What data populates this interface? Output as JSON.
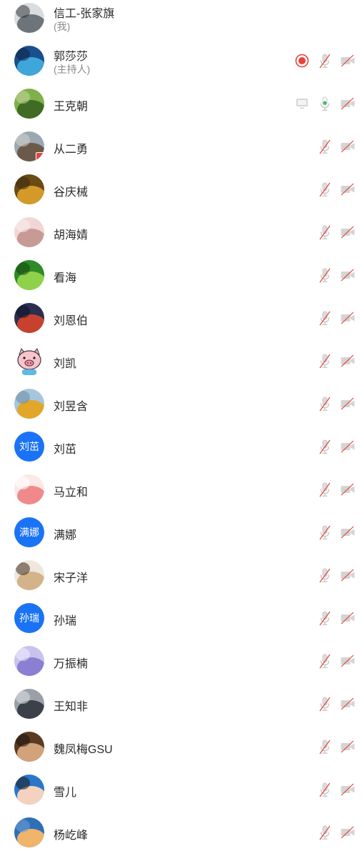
{
  "participants": [
    {
      "name": "信工-张家旗",
      "role": "(我)",
      "avatar": {
        "type": "photo",
        "colors": [
          "#d9dde0",
          "#6d747a",
          "#2e3439"
        ]
      },
      "icons": []
    },
    {
      "name": "郭莎莎",
      "role": "(主持人)",
      "avatar": {
        "type": "photo",
        "colors": [
          "#1a4f8f",
          "#3ea6d8",
          "#0c2346"
        ]
      },
      "icons": [
        "record-icon",
        "mic-muted-icon",
        "camera-off-icon"
      ]
    },
    {
      "name": "王克朝",
      "avatar": {
        "type": "photo",
        "colors": [
          "#7fb04a",
          "#3f6b22",
          "#c9d9a0"
        ]
      },
      "icons": [
        "screen-share-icon",
        "mic-active-icon",
        "camera-off-icon"
      ]
    },
    {
      "name": "从二勇",
      "avatar": {
        "type": "photo",
        "colors": [
          "#9aa8b3",
          "#6b5a4a",
          "#d8d2c8"
        ],
        "badge": true
      },
      "icons": [
        "mic-muted-icon",
        "camera-off-icon"
      ]
    },
    {
      "name": "谷庆械",
      "avatar": {
        "type": "photo",
        "colors": [
          "#6b4a16",
          "#d39a2a",
          "#3a2a10"
        ]
      },
      "icons": [
        "mic-muted-icon",
        "camera-off-icon"
      ]
    },
    {
      "name": "胡海婧",
      "avatar": {
        "type": "photo",
        "colors": [
          "#f0d6d4",
          "#c89a96",
          "#fbeeee"
        ]
      },
      "icons": [
        "mic-muted-icon",
        "camera-off-icon"
      ]
    },
    {
      "name": "看海",
      "avatar": {
        "type": "photo",
        "colors": [
          "#2f8a2a",
          "#8fd14a",
          "#13460f"
        ]
      },
      "icons": [
        "mic-muted-icon",
        "camera-off-icon"
      ]
    },
    {
      "name": "刘恩伯",
      "avatar": {
        "type": "photo",
        "colors": [
          "#2a2f52",
          "#c7412e",
          "#0f1124"
        ]
      },
      "icons": [
        "mic-muted-icon",
        "camera-off-icon"
      ]
    },
    {
      "name": "刘凯",
      "avatar": {
        "type": "pig"
      },
      "icons": [
        "mic-muted-icon",
        "camera-off-icon"
      ]
    },
    {
      "name": "刘昱含",
      "avatar": {
        "type": "photo",
        "colors": [
          "#a6c6dd",
          "#e2a72a",
          "#6e8aa0"
        ]
      },
      "icons": [
        "mic-muted-icon",
        "camera-off-icon"
      ]
    },
    {
      "name": "刘茁",
      "avatar": {
        "type": "text",
        "text": "刘茁",
        "color": "#1a73f5"
      },
      "icons": [
        "mic-muted-icon",
        "camera-off-icon"
      ]
    },
    {
      "name": "马立和",
      "avatar": {
        "type": "photo",
        "colors": [
          "#fde8e6",
          "#f08a8a",
          "#ffffff"
        ]
      },
      "icons": [
        "mic-muted-icon",
        "camera-off-icon"
      ]
    },
    {
      "name": "满娜",
      "avatar": {
        "type": "text",
        "text": "满娜",
        "color": "#1a73f5"
      },
      "icons": [
        "mic-muted-icon",
        "camera-off-icon"
      ]
    },
    {
      "name": "宋子洋",
      "avatar": {
        "type": "photo",
        "colors": [
          "#efe7dc",
          "#d2b38a",
          "#3a2a1a"
        ]
      },
      "icons": [
        "mic-muted-icon",
        "camera-off-icon"
      ]
    },
    {
      "name": "孙瑞",
      "avatar": {
        "type": "text",
        "text": "孙瑞",
        "color": "#1a73f5"
      },
      "icons": [
        "mic-muted-icon",
        "camera-off-icon"
      ]
    },
    {
      "name": "万振楠",
      "avatar": {
        "type": "photo",
        "colors": [
          "#c9c2ec",
          "#8a7fd0",
          "#f3f0ff"
        ]
      },
      "icons": [
        "mic-muted-icon",
        "camera-off-icon"
      ]
    },
    {
      "name": "王知非",
      "avatar": {
        "type": "photo",
        "colors": [
          "#9aa0a8",
          "#3c4048",
          "#e0e3e7"
        ]
      },
      "icons": [
        "mic-muted-icon",
        "camera-off-icon"
      ]
    },
    {
      "name": "魏凤梅GSU",
      "avatar": {
        "type": "photo",
        "colors": [
          "#5b3a22",
          "#d2a27a",
          "#1c1410"
        ]
      },
      "icons": [
        "mic-muted-icon",
        "camera-off-icon"
      ]
    },
    {
      "name": "雪儿",
      "avatar": {
        "type": "photo",
        "colors": [
          "#2a76c8",
          "#f4d2c0",
          "#1a1a1a"
        ]
      },
      "icons": [
        "mic-muted-icon",
        "camera-off-icon"
      ]
    },
    {
      "name": "杨屹峰",
      "avatar": {
        "type": "photo",
        "colors": [
          "#2f6fb8",
          "#f0b46a",
          "#6fa0d6"
        ]
      },
      "icons": [
        "mic-muted-icon",
        "camera-off-icon"
      ]
    }
  ],
  "colors": {
    "record": "#e8423a",
    "mic_active": "#34c759",
    "muted_slash": "#e8423a",
    "icon_gray": "#c8c8c8",
    "text_avatar": "#1a73f5"
  }
}
